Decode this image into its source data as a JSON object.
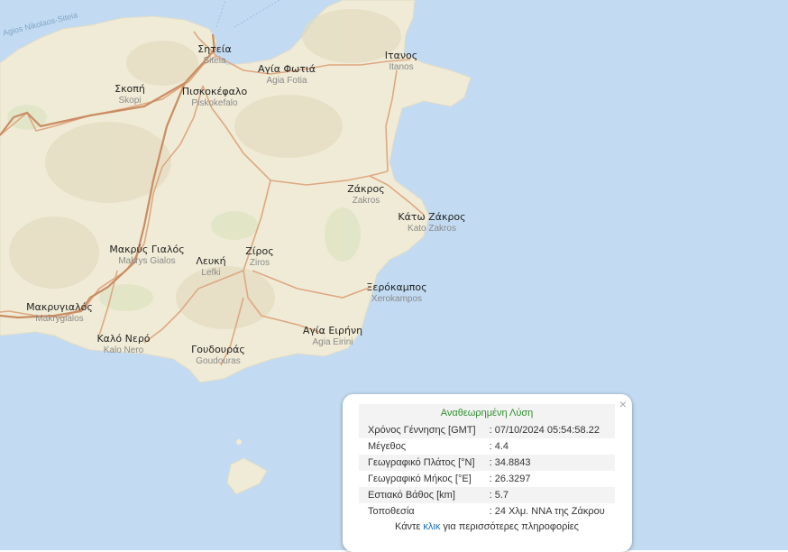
{
  "map": {
    "sea_color": "#c2dbf2",
    "land_color": "#f0ebd6",
    "road_color": "#dea882",
    "sea_label": "Agios Nikolaos-Siteia",
    "places": [
      {
        "gr": "Σητεία",
        "en": "Siteia"
      },
      {
        "gr": "Αγία Φωτιά",
        "en": "Agia Fotia"
      },
      {
        "gr": "Ιτανος",
        "en": "Itanos"
      },
      {
        "gr": "Σκοπή",
        "en": "Skopi"
      },
      {
        "gr": "Πισκοκέφαλο",
        "en": "Piskokefalo"
      },
      {
        "gr": "Ζάκρος",
        "en": "Zakros"
      },
      {
        "gr": "Κάτω Ζάκρος",
        "en": "Kato Zakros"
      },
      {
        "gr": "Μακρύς Γιαλός",
        "en": "Makrys Gialos"
      },
      {
        "gr": "Λευκή",
        "en": "Lefki"
      },
      {
        "gr": "Ζίρος",
        "en": "Ziros"
      },
      {
        "gr": "Ξερόκαμπος",
        "en": "Xerokampos"
      },
      {
        "gr": "Μακρυγιαλός",
        "en": "Makrygialos"
      },
      {
        "gr": "Αγία Ειρήνη",
        "en": "Agia Eirini"
      },
      {
        "gr": "Καλό Νερό",
        "en": "Kalo Nero"
      },
      {
        "gr": "Γουδουράς",
        "en": "Goudouras"
      }
    ]
  },
  "popup": {
    "title": "Αναθεωρημένη Λύση",
    "close": "×",
    "rows": [
      {
        "label": "Χρόνος Γέννησης [GMT]",
        "value": ": 07/10/2024 05:54:58.22"
      },
      {
        "label": "Μέγεθος",
        "value": ": 4.4"
      },
      {
        "label": "Γεωγραφικό Πλάτος [°N]",
        "value": ": 34.8843"
      },
      {
        "label": "Γεωγραφικό Μήκος [°E]",
        "value": ": 26.3297"
      },
      {
        "label": "Εστιακό Βάθος [km]",
        "value": ": 5.7"
      },
      {
        "label": "Τοποθεσία",
        "value": ": 24 Χλμ. ΝΝΑ της Ζάκρου"
      }
    ],
    "more_before": "Κάντε ",
    "more_link": "κλικ",
    "more_after": " για περισσότερες πληροφορίες"
  }
}
